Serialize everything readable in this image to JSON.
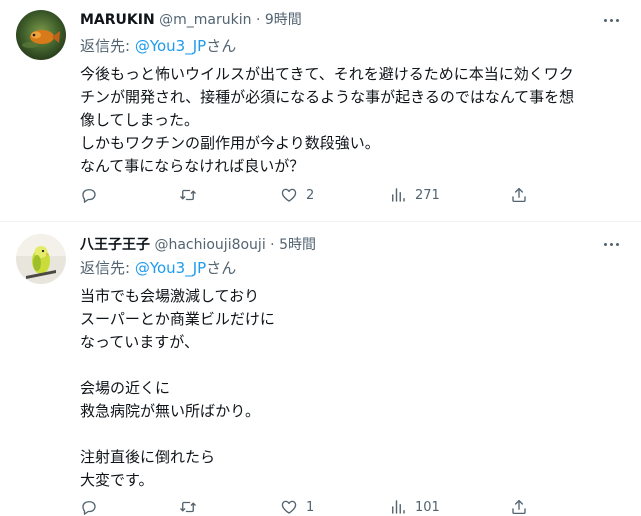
{
  "tweets": [
    {
      "name": "MARUKIN",
      "handle": "@m_marukin",
      "separator": "·",
      "time": "9時間",
      "reply_prefix": "返信先: ",
      "reply_to": "@You3_JP",
      "reply_suffix": "さん",
      "lines": [
        "今後もっと怖いウイルスが出てきて、それを避けるために本当に効くワク",
        "チンが開発され、接種が必須になるような事が起きるのではなんて事を想",
        "像してしまった。",
        "しかもワクチンの副作用が今より数段強い。",
        "なんて事にならなければ良いが？"
      ],
      "likes": "2",
      "views": "271"
    },
    {
      "name": "八王子王子",
      "handle": "@hachiouji8ouji",
      "separator": "·",
      "time": "5時間",
      "reply_prefix": "返信先: ",
      "reply_to": "@You3_JP",
      "reply_suffix": "さん",
      "lines": [
        "当市でも会場激減しており",
        "スーパーとか商業ビルだけに",
        "なっていますが、",
        "",
        "会場の近くに",
        "救急病院が無い所ばかり。",
        "",
        "注射直後に倒れたら",
        "大変です。"
      ],
      "likes": "1",
      "views": "101"
    }
  ],
  "icons": {
    "more": "more-horizontal-icon",
    "reply": "reply-bubble-icon",
    "retweet": "retweet-icon",
    "like": "heart-icon",
    "views": "analytics-bars-icon",
    "share": "share-upload-icon"
  },
  "colors": {
    "text": "#0f1419",
    "secondary": "#536471",
    "link": "#1d9bf0",
    "divider": "#eff3f4"
  }
}
